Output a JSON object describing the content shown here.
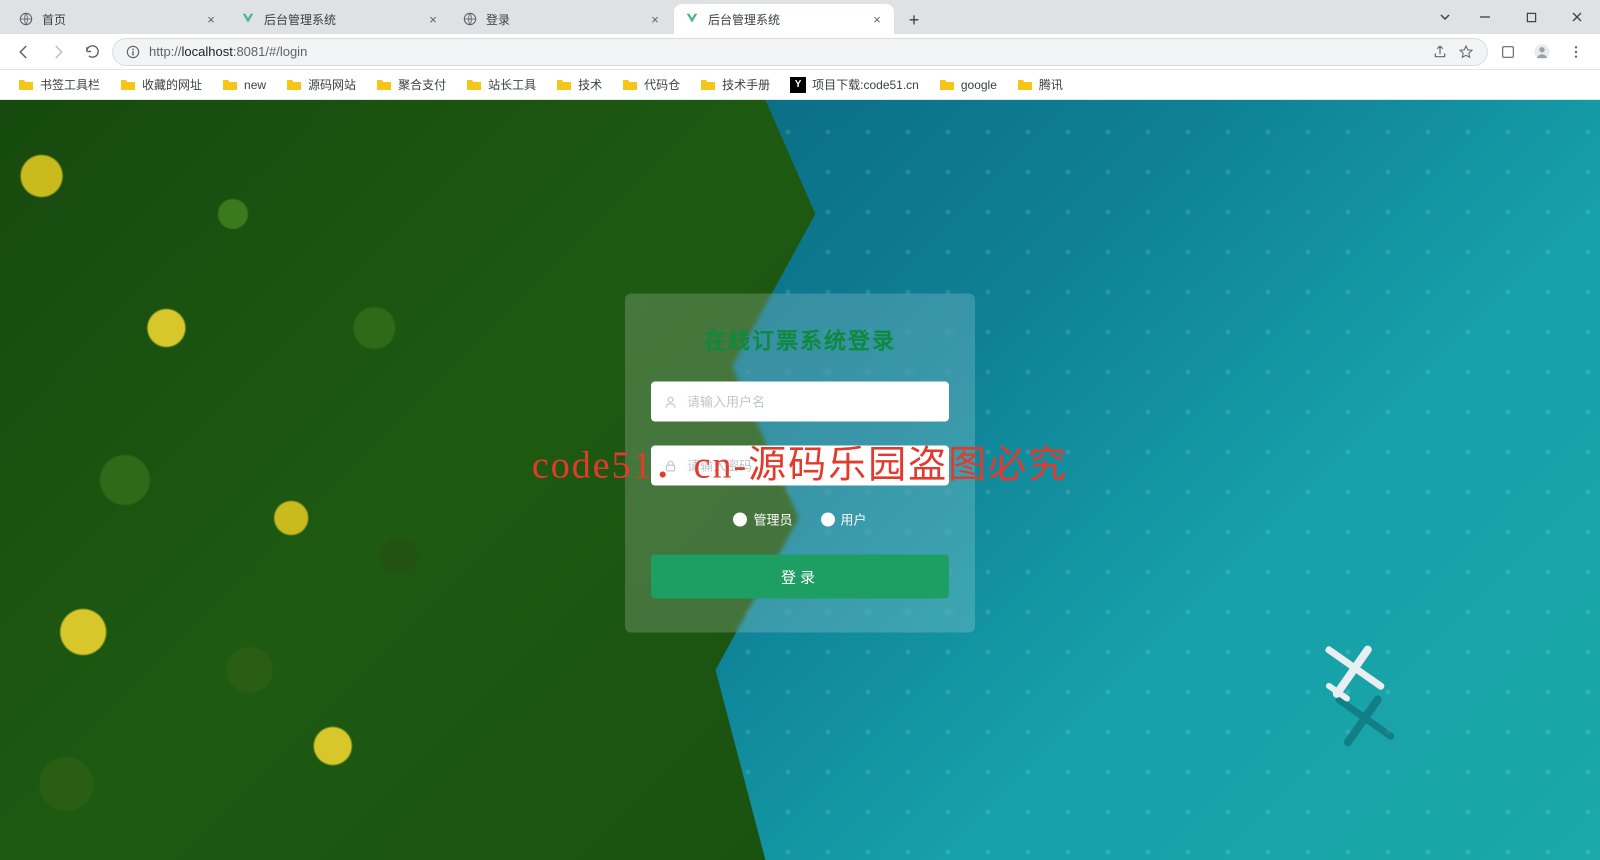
{
  "browser": {
    "tabs": [
      {
        "title": "首页",
        "icon": "globe"
      },
      {
        "title": "后台管理系统",
        "icon": "vue"
      },
      {
        "title": "登录",
        "icon": "globe"
      },
      {
        "title": "后台管理系统",
        "icon": "vue",
        "active": true
      }
    ],
    "url_host": "localhost",
    "url_prefix": "http://",
    "url_rest": ":8081/#/login"
  },
  "bookmarks": [
    {
      "label": "书签工具栏",
      "type": "folder"
    },
    {
      "label": "收藏的网址",
      "type": "folder"
    },
    {
      "label": "new",
      "type": "folder"
    },
    {
      "label": "源码网站",
      "type": "folder"
    },
    {
      "label": "聚合支付",
      "type": "folder"
    },
    {
      "label": "站长工具",
      "type": "folder"
    },
    {
      "label": "技术",
      "type": "folder"
    },
    {
      "label": "代码仓",
      "type": "folder"
    },
    {
      "label": "技术手册",
      "type": "folder"
    },
    {
      "label": "项目下载:code51.cn",
      "type": "site"
    },
    {
      "label": "google",
      "type": "folder"
    },
    {
      "label": "腾讯",
      "type": "folder"
    }
  ],
  "login": {
    "title": "在线订票系统登录",
    "username_placeholder": "请输入用户名",
    "password_placeholder": "请输入密码",
    "role_admin": "管理员",
    "role_user": "用户",
    "submit": "登录"
  },
  "watermark": "code51．cn-源码乐园盗图必究"
}
